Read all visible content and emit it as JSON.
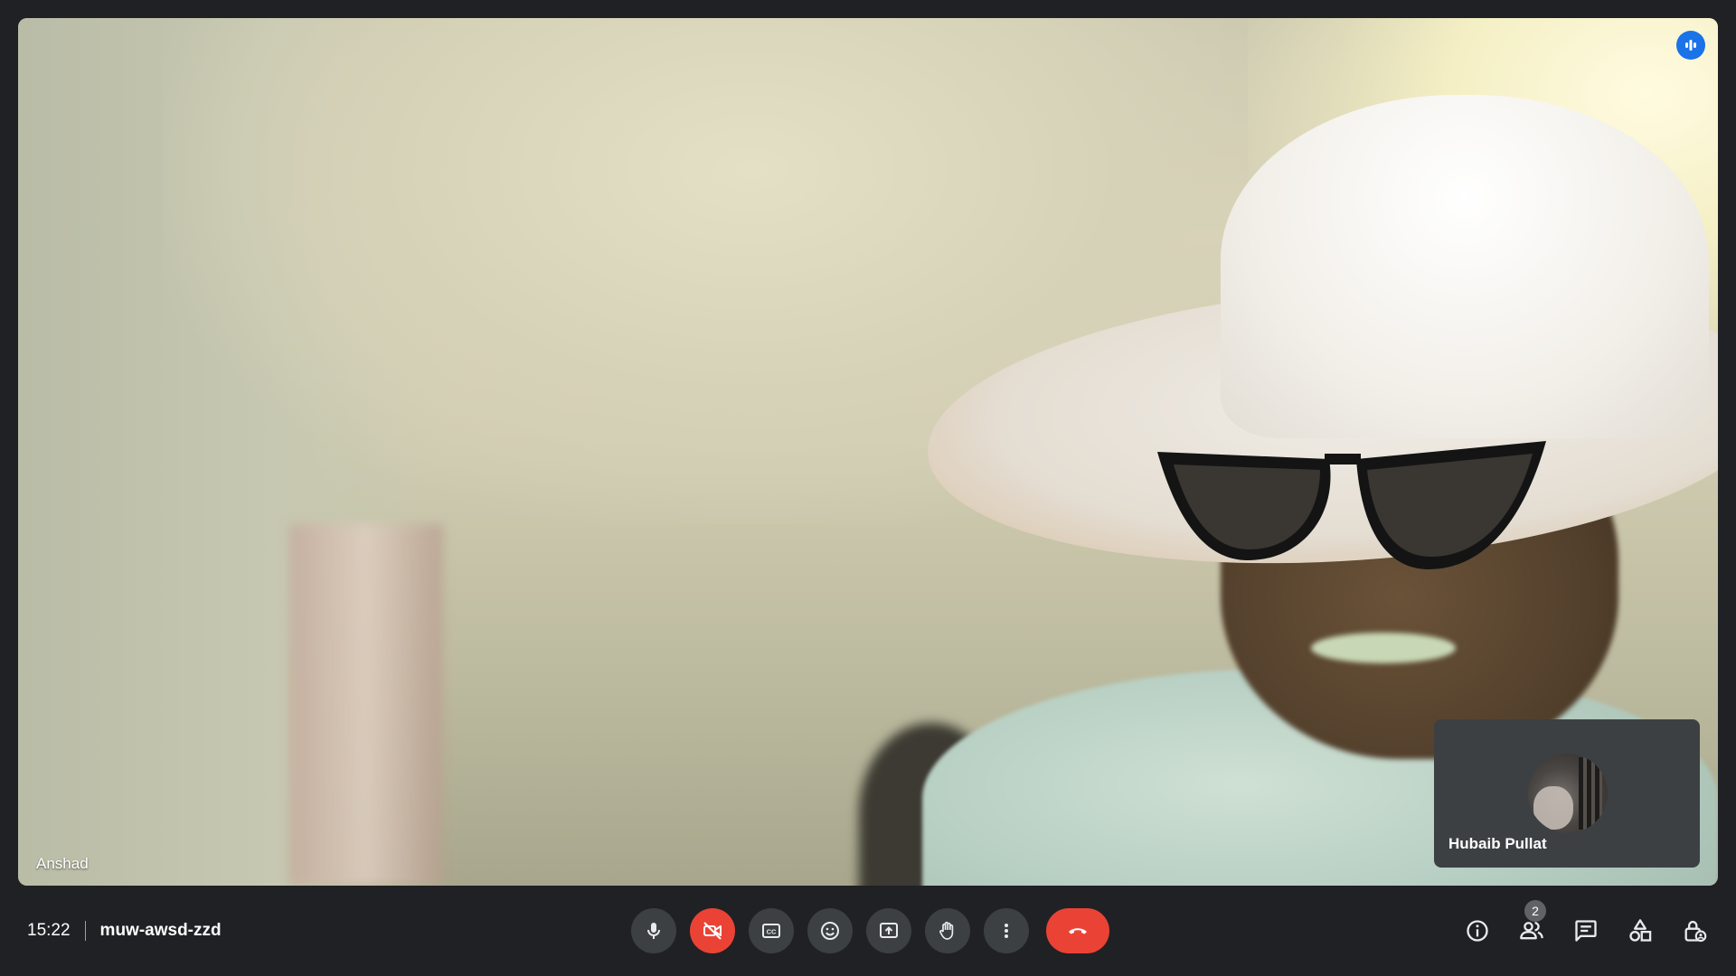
{
  "main_video": {
    "participant_name": "Anshad",
    "speaking_icon": "audio-level-icon"
  },
  "self_view": {
    "participant_name": "Hubaib Pullat",
    "camera_on": false
  },
  "meeting": {
    "time": "15:22",
    "code": "muw-awsd-zzd"
  },
  "controls": [
    {
      "name": "microphone",
      "icon": "mic-icon"
    },
    {
      "name": "camera",
      "icon": "video-off-icon",
      "state": "off"
    },
    {
      "name": "captions",
      "icon": "closed-captions-icon"
    },
    {
      "name": "reactions",
      "icon": "emoji-icon"
    },
    {
      "name": "present",
      "icon": "present-screen-icon"
    },
    {
      "name": "raise-hand",
      "icon": "hand-icon"
    },
    {
      "name": "more-options",
      "icon": "more-vert-icon"
    },
    {
      "name": "leave-call",
      "icon": "call-end-icon"
    }
  ],
  "right_tools": {
    "people_count": "2",
    "items": [
      "info-icon",
      "people-icon",
      "chat-icon",
      "activities-icon",
      "host-controls-icon"
    ]
  },
  "colors": {
    "background": "#202124",
    "control_bg": "#3c4043",
    "danger": "#ea4335",
    "accent": "#1a73e8"
  }
}
